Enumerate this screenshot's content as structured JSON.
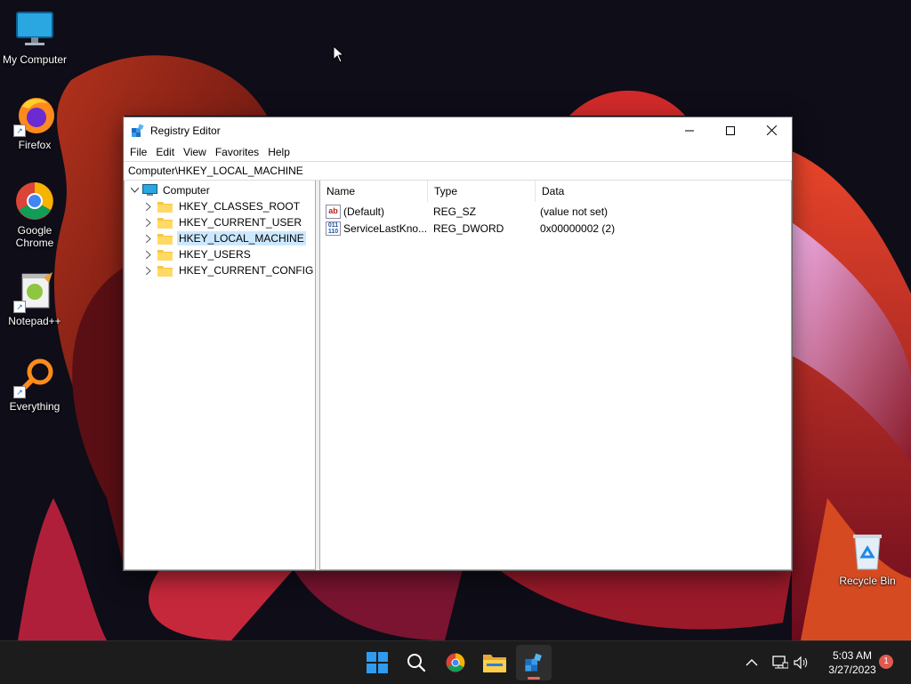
{
  "desktop": {
    "icons": [
      {
        "label": "My Computer",
        "icon": "monitor-icon"
      },
      {
        "label": "Firefox",
        "icon": "firefox-icon"
      },
      {
        "label": "Google Chrome",
        "icon": "chrome-icon"
      },
      {
        "label": "Notepad++",
        "icon": "notepad-plus-plus-icon"
      },
      {
        "label": "Everything",
        "icon": "magnifier-icon"
      },
      {
        "label": "Recycle Bin",
        "icon": "recycle-bin-icon"
      }
    ]
  },
  "window": {
    "title": "Registry Editor",
    "controls": {
      "minimize": "—",
      "maximize": "☐",
      "close": "✕"
    },
    "menu": [
      "File",
      "Edit",
      "View",
      "Favorites",
      "Help"
    ],
    "address": "Computer\\HKEY_LOCAL_MACHINE",
    "tree": {
      "root": "Computer",
      "items": [
        "HKEY_CLASSES_ROOT",
        "HKEY_CURRENT_USER",
        "HKEY_LOCAL_MACHINE",
        "HKEY_USERS",
        "HKEY_CURRENT_CONFIG"
      ],
      "selected": "HKEY_LOCAL_MACHINE"
    },
    "columns": [
      "Name",
      "Type",
      "Data"
    ],
    "rows": [
      {
        "name": "(Default)",
        "type": "REG_SZ",
        "data": "(value not set)",
        "icon": "ab"
      },
      {
        "name": "ServiceLastKno...",
        "type": "REG_DWORD",
        "data": "0x00000002 (2)",
        "icon": "011 110"
      }
    ]
  },
  "taskbar": {
    "apps": [
      "start-icon",
      "search-icon",
      "chrome-icon",
      "file-explorer-icon",
      "registry-editor-icon"
    ],
    "clock": {
      "time": "5:03 AM",
      "date": "3/27/2023"
    },
    "notifications": "1"
  },
  "colors": {
    "selection": "#cce8ff",
    "taskbar": "#1c1c1c",
    "accent": "#0078d4"
  }
}
